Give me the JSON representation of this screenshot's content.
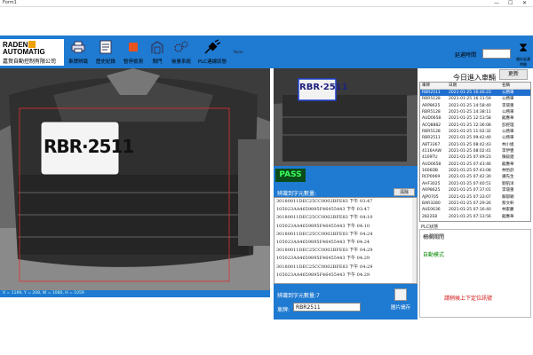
{
  "window": {
    "title": "Form1",
    "controls": [
      "—",
      "☐",
      "✕"
    ]
  },
  "logo": {
    "line1": "RADEN",
    "line2": "AUTOMATIG",
    "line3": "嘉賀自動控制有限公司"
  },
  "toolbar": {
    "buttons": [
      {
        "label": "車牌辨識",
        "icon": "printer-icon"
      },
      {
        "label": "歷史紀錄",
        "icon": "document-icon"
      },
      {
        "label": "暫停檢測",
        "icon": "stop-icon"
      },
      {
        "label": "閘門",
        "icon": "gate-icon"
      },
      {
        "label": "後臺系統",
        "icon": "gears-icon"
      },
      {
        "label": "PLC連線狀態",
        "icon": "plug-icon"
      }
    ],
    "status_small": "None",
    "delay_label": "延遲時間",
    "hourglass_label": "儲存延遲時間"
  },
  "camera": {
    "plate_text": "RBR·2511",
    "status": "X = 1169, Y = 208, W = 1080, H = 1059"
  },
  "result": {
    "pass": "PASS",
    "count_label": "辨識到字元數量:",
    "clear_label": "清除",
    "log": [
      "30180011DEC25CC0002BFE83  下午 03:47",
      "105023AA4659895F46455443  下午 03:47",
      "30180011DEC25CC0002BFE83  下午 04:10",
      "105023AA4659895F46455443  下午 04:10",
      "30180011DEC25CC0002BFE83  下午 04:24",
      "105023AA4659895F46455443  下午 04:24",
      "30180011DEC25CC0002BFE83  下午 04:29",
      "105023AA4659895F46455443  下午 04:29",
      "30180011DEC25CC0002BFE83  下午 04:29",
      "105023AA4659895F46455443  下午 04:29"
    ],
    "count_result": "辨識到字元數量:7",
    "plate_label": "車牌:",
    "plate_value": "RBR2511",
    "save_label": "圖片儲存"
  },
  "side": {
    "title": "今日進入車輛",
    "refresh": "更新",
    "headers": [
      "車牌",
      "日期",
      "名稱"
    ],
    "rows": [
      [
        "RBR2511",
        "2021-01-25 16:46:23",
        "公務車"
      ],
      [
        "RBR5128",
        "2021-01-25 16:11:59",
        "公務車"
      ],
      [
        "ARP8625",
        "2021-01-25 14:58:40",
        "李璟重"
      ],
      [
        "RBR5128",
        "2021-01-25 14:38:11",
        "公務車"
      ],
      [
        "AUD0658",
        "2021-01-25 12:53:58",
        "龍應華"
      ],
      [
        "ACQ8882",
        "2021-01-25 12:36:08",
        "彭經理"
      ],
      [
        "RBR5128",
        "2021-01-25 11:02:32",
        "公務車"
      ],
      [
        "RBR2511",
        "2021-01-25 09:42:40",
        "公務車"
      ],
      [
        "ABT3367",
        "2021-01-25 08:42:43",
        "林小姐"
      ],
      [
        "4116AAW",
        "2021-01-25 08:02:41",
        "李伊豐"
      ],
      [
        "4109TU",
        "2021-01-25 07:49:23",
        "陳毅錕"
      ],
      [
        "AUD0658",
        "2021-01-25 07:43:46",
        "龍應華"
      ],
      [
        "1606DB",
        "2021-01-25 07:43:08",
        "林怡舒"
      ],
      [
        "RCP0069",
        "2021-01-25 07:42:30",
        "鍾先生"
      ],
      [
        "AHF3025",
        "2021-01-25 07:40:51",
        "劉凱洋"
      ],
      [
        "ARP8625",
        "2021-01-25 07:37:01",
        "李璟重"
      ],
      [
        "AJP0705",
        "2021-01-25 07:33:07",
        "蘇郁穎"
      ],
      [
        "BAR3280",
        "2021-01-25 07:29:26",
        "蔡文軒"
      ],
      [
        "AUE0636",
        "2021-01-25 07:16:40",
        "林家慶"
      ],
      [
        "2822E8",
        "2021-01-25 07:13:56",
        "龍應華"
      ]
    ],
    "plc_head": "PLC狀態",
    "plc_gate": "柵欄關閉",
    "plc_mode": "自動模式",
    "plc_msg": "請稍候上下定位訊號"
  }
}
